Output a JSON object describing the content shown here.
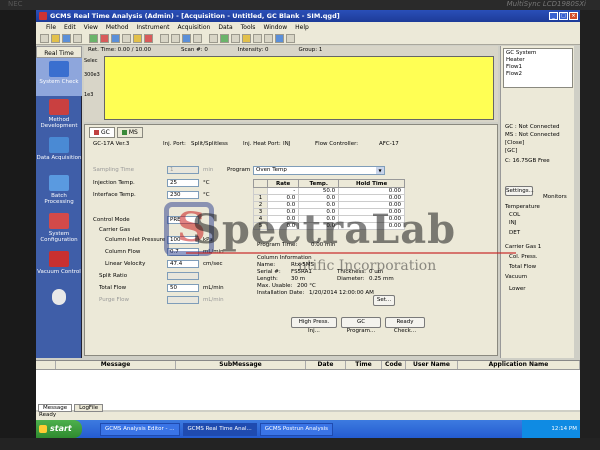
{
  "bezel": {
    "brand": "MultiSync LCD1980SXi",
    "logo": "NEC"
  },
  "window": {
    "title": "GCMS Real Time Analysis (Admin) - [Acquisition - Untitled, GC Blank - SIM.qgd]"
  },
  "menu": [
    "File",
    "Edit",
    "View",
    "Method",
    "Instrument",
    "Acquisition",
    "Data",
    "Tools",
    "Window",
    "Help"
  ],
  "leftnav": {
    "header": "Real Time",
    "items": [
      {
        "label": "System Check",
        "color": "#3a6fcf"
      },
      {
        "label": "Method Development",
        "color": "#c94040"
      },
      {
        "label": "Data Acquisition",
        "color": "#4a8ad4"
      },
      {
        "label": "Batch Processing",
        "color": "#5a9ae0"
      },
      {
        "label": "System Configuration",
        "color": "#d24a4a"
      },
      {
        "label": "Vacuum Control",
        "color": "#c83030"
      }
    ]
  },
  "graph": {
    "ret_time": "Ret. Time: 0.00 / 10.00",
    "scan": "Scan #: 0",
    "intensity": "Intensity: 0",
    "group": "Group: 1",
    "y_labels": [
      "Selec",
      "300e3",
      "1e3"
    ],
    "fill_color": "#ffff54"
  },
  "tabs": {
    "gc": "GC",
    "ms": "MS"
  },
  "header_row": {
    "model": "GC-17A Ver.3",
    "inj_port_label": "Inj. Port:",
    "inj_port_value": "Split/Splitless",
    "heat_port_label": "Inj. Heat Port:",
    "heat_port_value": "INJ",
    "flow_ctrl_label": "Flow Controller:",
    "flow_ctrl_value": "AFC-17"
  },
  "form": {
    "sampling_time": {
      "label": "Sampling Time",
      "value": "1",
      "unit": "min"
    },
    "injection_temp": {
      "label": "Injection Temp.",
      "value": "25",
      "unit": "°C"
    },
    "interface_temp": {
      "label": "Interface Temp.",
      "value": "230",
      "unit": "°C"
    },
    "control_mode": {
      "label": "Control Mode",
      "value": "PRE"
    },
    "carrier_gas": "Carrier Gas",
    "column_inlet_pressure": {
      "label": "Column Inlet Pressure",
      "value": "100",
      "unit": "kPa"
    },
    "column_flow": {
      "label": "Column Flow",
      "value": "0.7",
      "unit": "mL/min"
    },
    "linear_velocity": {
      "label": "Linear Velocity",
      "value": "47.4",
      "unit": "cm/sec"
    },
    "split_ratio": {
      "label": "Split Ratio",
      "value": ""
    },
    "total_flow": {
      "label": "Total Flow",
      "value": "50",
      "unit": "mL/min"
    },
    "purge_flow": {
      "label": "Purge Flow",
      "value": "",
      "unit": "mL/min"
    }
  },
  "program": {
    "label": "Program",
    "selected": "Oven Temp",
    "columns": [
      "Rate",
      "Temp.",
      "Hold Time"
    ],
    "rows": [
      {
        "idx": "",
        "rate": "-",
        "temp": "50.0",
        "hold": "0.00"
      },
      {
        "idx": "1",
        "rate": "0.0",
        "temp": "0.0",
        "hold": "0.00"
      },
      {
        "idx": "2",
        "rate": "0.0",
        "temp": "0.0",
        "hold": "0.00"
      },
      {
        "idx": "3",
        "rate": "0.0",
        "temp": "0.0",
        "hold": "0.00"
      },
      {
        "idx": "4",
        "rate": "0.0",
        "temp": "0.0",
        "hold": "0.00"
      },
      {
        "idx": "5",
        "rate": "0.0",
        "temp": "0.0",
        "hold": "0.00"
      }
    ],
    "program_time_label": "Program Time:",
    "program_time_value": "0.00 min"
  },
  "column_info": {
    "title": "Column Information",
    "name_label": "Name:",
    "name_value": "Rtx-5MS",
    "serial_label": "Serial #:",
    "serial_value": "FS5RA1",
    "thickness_label": "Thickness:",
    "thickness_value": "0 um",
    "length_label": "Length:",
    "length_value": "30 m",
    "diameter_label": "Diameter:",
    "diameter_value": "0.25 mm",
    "max_usable_label": "Max. Usable:",
    "max_usable_value": "200 °C",
    "install_date_label": "Installation Date:",
    "install_date_value": "1/20/2014 12:00:00 AM",
    "set_button": "Set..."
  },
  "buttons": {
    "high_press_inj": "High Press. Inj...",
    "gc_program": "GC Program...",
    "ready_check": "Ready Check..."
  },
  "watermark": {
    "main": "SpectraLab",
    "sub": "ntific Incorporation",
    "logo": "S"
  },
  "right_panel": {
    "status_list": [
      "GC System",
      "Heater",
      "Flow1",
      "Flow2"
    ],
    "gc_status": "GC : Not Connected",
    "ms_status": "MS : Not Connected",
    "state": "[Close]",
    "gc_label": "[GC]",
    "free_space": "C: 16.75GB Free",
    "settings_button": "Settings...",
    "monitors": "Monitors",
    "temperature": "Temperature",
    "col": "COL",
    "inj": "INJ",
    "det": "DET",
    "carrier_gas": "Carrier Gas 1",
    "col_press": "Col. Press.",
    "total_flow": "Total Flow",
    "vacuum": "Vacuum",
    "lower": "Lower"
  },
  "messages": {
    "columns": [
      "",
      "Message",
      "SubMessage",
      "Date",
      "Time",
      "Code",
      "User Name",
      "Application Name"
    ],
    "tabs": [
      "Message",
      "LogFile"
    ]
  },
  "status_bar": "Ready",
  "taskbar": {
    "start": "start",
    "tasks": [
      "GCMS Analysis Editor - ...",
      "GCMS Real Time Anal...",
      "GCMS Postrun Analysis"
    ],
    "time": "12:14 PM"
  }
}
